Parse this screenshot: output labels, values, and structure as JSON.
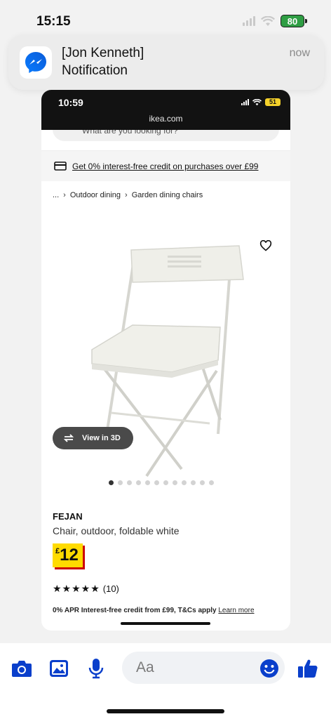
{
  "status_bar": {
    "time": "15:15",
    "battery": "80"
  },
  "notification": {
    "app_icon": "messenger-icon",
    "title": "[Jon Kenneth]",
    "body": "Notification",
    "time": "now"
  },
  "screenshot": {
    "status_time": "10:59",
    "battery": "51",
    "url": "ikea.com",
    "search_placeholder": "What are you looking for?",
    "credit_banner": "Get 0% interest-free credit on purchases over £99",
    "breadcrumb": [
      "...",
      "Outdoor dining",
      "Garden dining chairs"
    ],
    "view_3d": "View in 3D",
    "carousel": {
      "count": 12,
      "active": 0
    },
    "product": {
      "name": "FEJAN",
      "description": "Chair, outdoor, foldable white",
      "currency": "£",
      "price": "12",
      "stars": "★★★★★",
      "reviews": "(10)",
      "apr": "0% APR Interest-free credit from £99, T&Cs apply",
      "learn_more": "Learn more"
    }
  },
  "bottom_bar": {
    "placeholder": "Aa",
    "icons": [
      "camera-icon",
      "gallery-icon",
      "microphone-icon",
      "emoji-icon",
      "thumbs-up-icon"
    ]
  },
  "colors": {
    "messenger_blue": "#0a3fcb",
    "ikea_yellow": "#ffdb00",
    "ikea_red": "#cc0008"
  }
}
